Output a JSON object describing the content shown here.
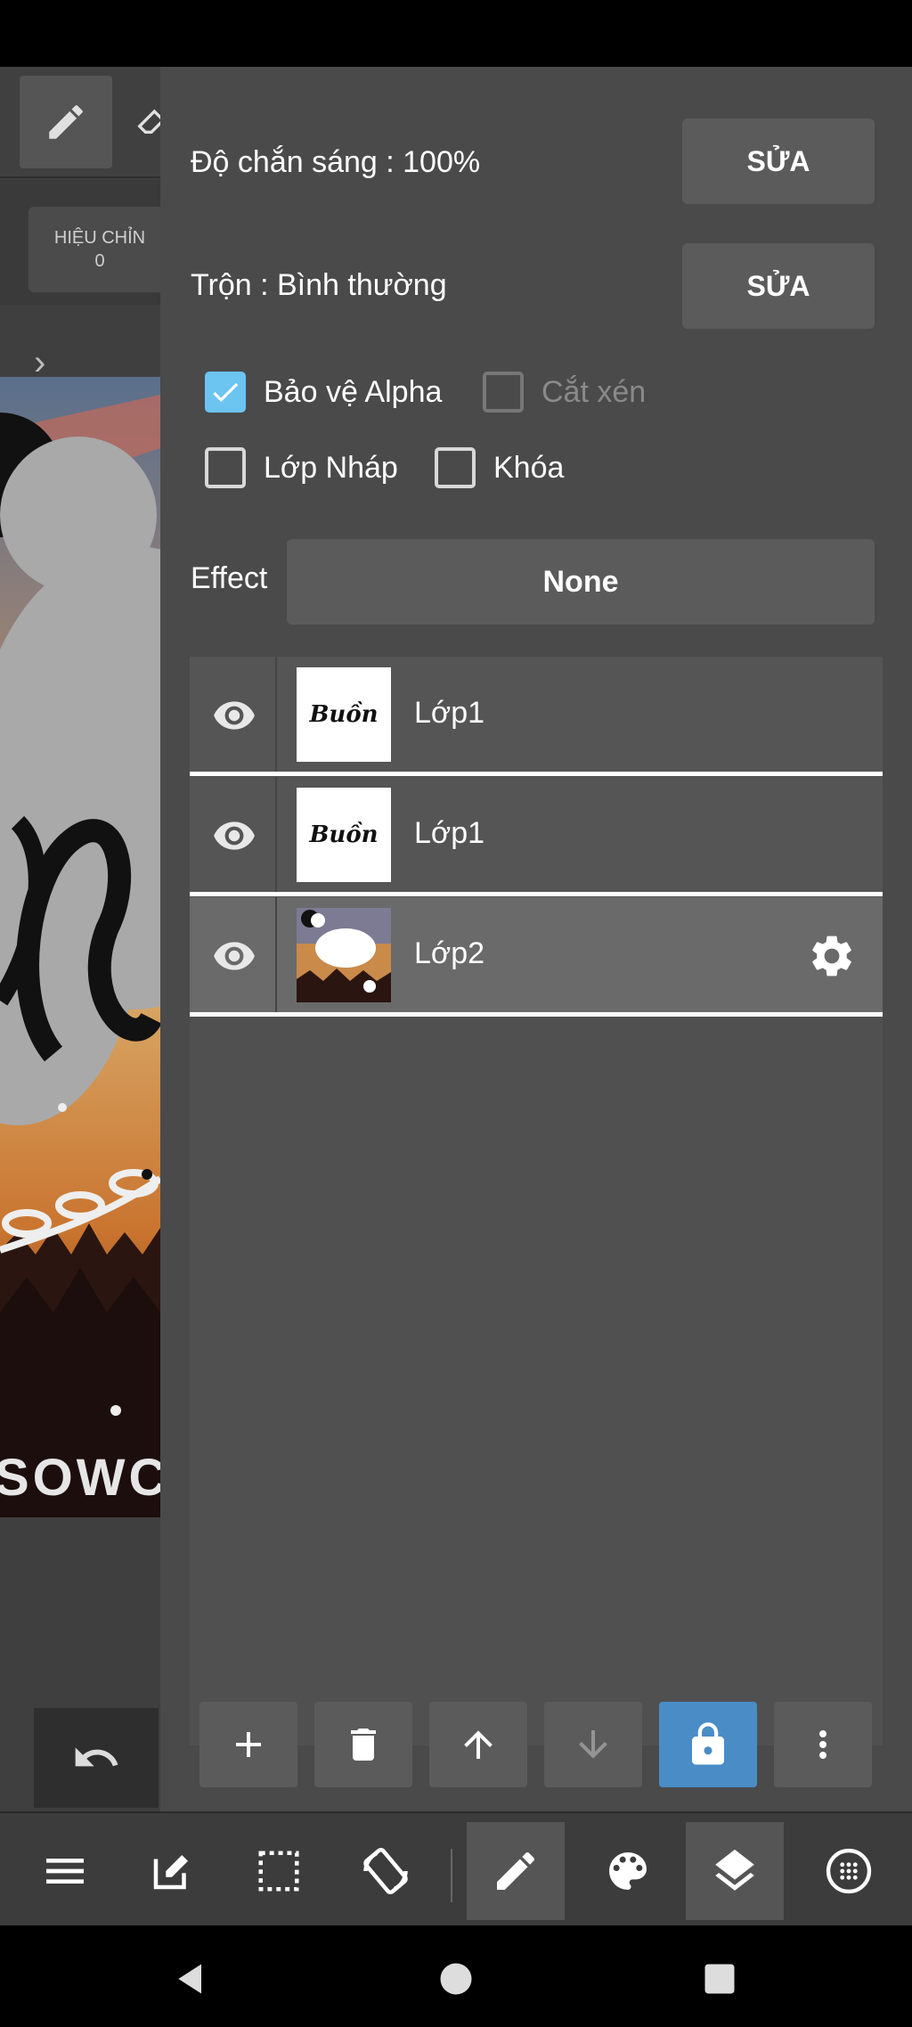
{
  "canvas": {
    "adjust_label": "HIỆU CHỈN",
    "adjust_value": "0",
    "art_text": "SOWC"
  },
  "panel": {
    "opacity": {
      "label": "Độ chắn sáng : 100%",
      "button": "SỬA"
    },
    "blend": {
      "label": "Trộn : Bình thường",
      "button": "SỬA"
    },
    "checkboxes": [
      {
        "label": "Bảo vệ Alpha",
        "checked": true,
        "enabled": true
      },
      {
        "label": "Cắt xén",
        "checked": false,
        "enabled": false
      },
      {
        "label": "Lớp Nháp",
        "checked": false,
        "enabled": true
      },
      {
        "label": "Khóa",
        "checked": false,
        "enabled": true
      }
    ],
    "effect": {
      "label": "Effect",
      "value": "None"
    },
    "layers": [
      {
        "name": "Lớp1",
        "thumb_text": "Buồn",
        "visible": true,
        "selected": false
      },
      {
        "name": "Lớp1",
        "thumb_text": "Buồn",
        "visible": true,
        "selected": false
      },
      {
        "name": "Lớp2",
        "thumb_text": "",
        "visible": true,
        "selected": true
      }
    ],
    "actions": [
      "add-icon",
      "delete-icon",
      "arrow-up-icon",
      "arrow-down-icon",
      "lock-icon",
      "more-vert-icon"
    ]
  },
  "toolbar": {
    "items": [
      "menu-icon",
      "edit-icon",
      "selection-icon",
      "rotate-icon",
      "brush-icon",
      "palette-icon",
      "layers-icon",
      "material-icon"
    ],
    "active": [
      "brush-icon",
      "layers-icon"
    ]
  },
  "colors": {
    "panel_bg": "#4a4a4a",
    "button_bg": "#5b5b5b",
    "accent_blue": "#4a8cc6",
    "checkbox_blue": "#6cc4f1"
  }
}
